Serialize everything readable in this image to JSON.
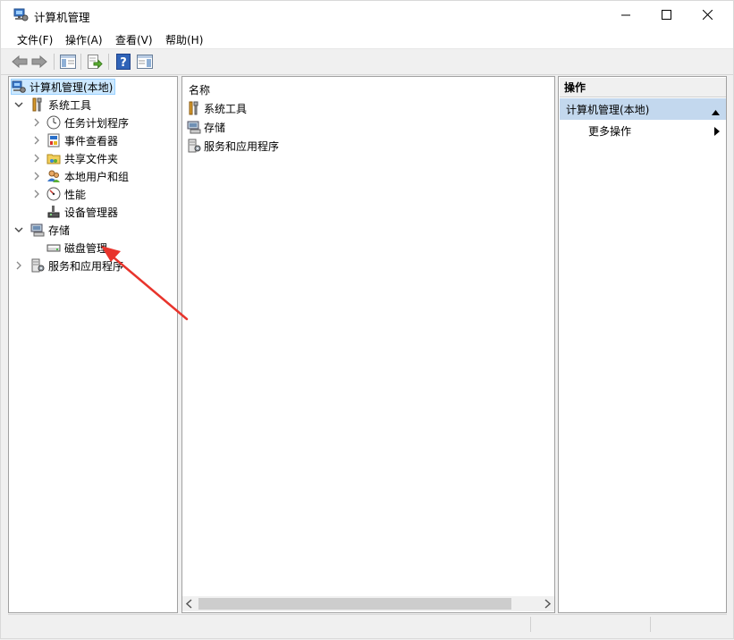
{
  "window": {
    "title": "计算机管理"
  },
  "menu": [
    "文件(F)",
    "操作(A)",
    "查看(V)",
    "帮助(H)"
  ],
  "toolbar": {
    "buttons": [
      "back-icon",
      "forward-icon",
      "show-tree-icon",
      "export-list-icon",
      "help-icon",
      "show-action-pane-icon"
    ]
  },
  "tree": {
    "root": "计算机管理(本地)",
    "system_tools": "系统工具",
    "task_scheduler": "任务计划程序",
    "event_viewer": "事件查看器",
    "shared_folders": "共享文件夹",
    "local_users": "本地用户和组",
    "performance": "性能",
    "device_manager": "设备管理器",
    "storage": "存储",
    "disk_management": "磁盘管理",
    "services_apps": "服务和应用程序"
  },
  "list": {
    "header": "名称",
    "items": [
      "系统工具",
      "存储",
      "服务和应用程序"
    ]
  },
  "actions": {
    "header": "操作",
    "group": "计算机管理(本地)",
    "more": "更多操作"
  },
  "colors": {
    "selection": "#cce8ff",
    "action_group": "#c3d8ee",
    "arrow": "#e8342c"
  }
}
